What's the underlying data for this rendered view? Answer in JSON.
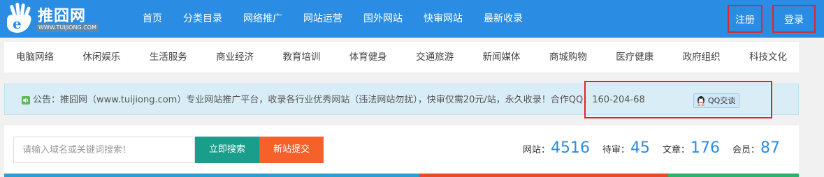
{
  "logo": {
    "name": "推囧网",
    "url": "WWW.TUIJIONG.COM"
  },
  "main_nav": [
    "首页",
    "分类目录",
    "网络推广",
    "网站运营",
    "国外网站",
    "快审网站",
    "最新收录"
  ],
  "auth": {
    "register": "注册",
    "login": "登录"
  },
  "categories": [
    "电脑网络",
    "休闲娱乐",
    "生活服务",
    "商业经济",
    "教育培训",
    "体育健身",
    "交通旅游",
    "新闻媒体",
    "商城购物",
    "医疗健康",
    "政府组织",
    "科技文化"
  ],
  "notice": {
    "text": "公告：推囧网（www.tuijiong.com）专业网站推广平台，收录各行业优秀网站（违法网站勿扰），快审仅需20元/站，永久收录！合作QQ：160-204-68",
    "qq_button": "QQ交谈"
  },
  "search": {
    "placeholder": "请输入域名或关键词搜索！",
    "search_button": "立即搜索",
    "submit_button": "新站提交"
  },
  "stats": [
    {
      "label": "网站：",
      "value": "4516"
    },
    {
      "label": "待审：",
      "value": "45"
    },
    {
      "label": "文章：",
      "value": "176"
    },
    {
      "label": "会员：",
      "value": "87"
    }
  ],
  "colors": {
    "brand_blue": "#2a8de3",
    "highlight_red": "#e0262c",
    "search_green": "#1a9d8b",
    "submit_orange": "#f5602b",
    "notice_bg": "#d9edf7"
  }
}
